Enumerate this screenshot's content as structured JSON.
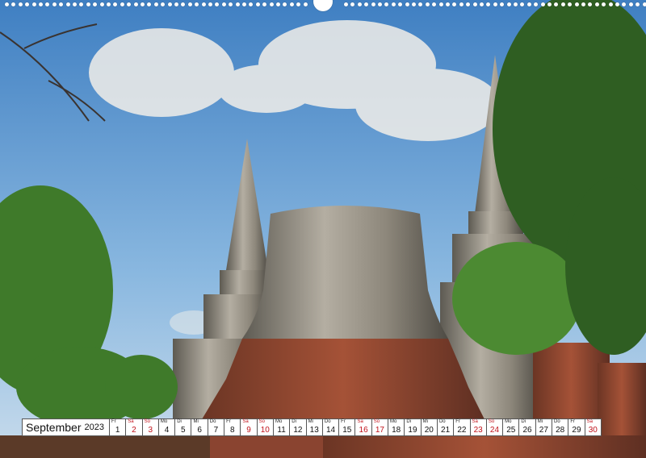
{
  "calendar": {
    "month": "September",
    "year": "2023",
    "days": [
      {
        "wd": "Fr",
        "n": "1",
        "we": false
      },
      {
        "wd": "Sa",
        "n": "2",
        "we": true
      },
      {
        "wd": "So",
        "n": "3",
        "we": true
      },
      {
        "wd": "Mo",
        "n": "4",
        "we": false
      },
      {
        "wd": "Di",
        "n": "5",
        "we": false
      },
      {
        "wd": "Mi",
        "n": "6",
        "we": false
      },
      {
        "wd": "Do",
        "n": "7",
        "we": false
      },
      {
        "wd": "Fr",
        "n": "8",
        "we": false
      },
      {
        "wd": "Sa",
        "n": "9",
        "we": true
      },
      {
        "wd": "So",
        "n": "10",
        "we": true
      },
      {
        "wd": "Mo",
        "n": "11",
        "we": false
      },
      {
        "wd": "Di",
        "n": "12",
        "we": false
      },
      {
        "wd": "Mi",
        "n": "13",
        "we": false
      },
      {
        "wd": "Do",
        "n": "14",
        "we": false
      },
      {
        "wd": "Fr",
        "n": "15",
        "we": false
      },
      {
        "wd": "Sa",
        "n": "16",
        "we": true
      },
      {
        "wd": "So",
        "n": "17",
        "we": true
      },
      {
        "wd": "Mo",
        "n": "18",
        "we": false
      },
      {
        "wd": "Di",
        "n": "19",
        "we": false
      },
      {
        "wd": "Mi",
        "n": "20",
        "we": false
      },
      {
        "wd": "Do",
        "n": "21",
        "we": false
      },
      {
        "wd": "Fr",
        "n": "22",
        "we": false
      },
      {
        "wd": "Sa",
        "n": "23",
        "we": true
      },
      {
        "wd": "So",
        "n": "24",
        "we": true
      },
      {
        "wd": "Mo",
        "n": "25",
        "we": false
      },
      {
        "wd": "Di",
        "n": "26",
        "we": false
      },
      {
        "wd": "Mi",
        "n": "27",
        "we": false
      },
      {
        "wd": "Do",
        "n": "28",
        "we": false
      },
      {
        "wd": "Fr",
        "n": "29",
        "we": false
      },
      {
        "wd": "Sa",
        "n": "30",
        "we": true
      }
    ]
  },
  "colors": {
    "sky": "#6aa0d4",
    "brick": "#9b4a32",
    "weekend": "#c0121a"
  }
}
